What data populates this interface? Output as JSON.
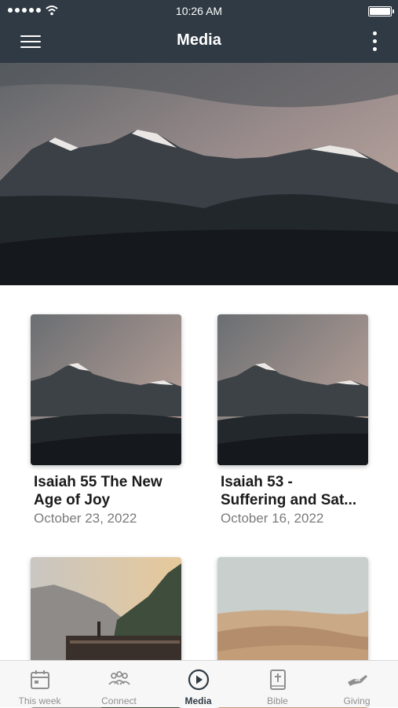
{
  "status": {
    "time": "10:26 AM"
  },
  "nav": {
    "title": "Media"
  },
  "items": [
    {
      "title": "Isaiah 55 The New\nAge of Joy",
      "date": "October 23, 2022"
    },
    {
      "title": "Isaiah 53 -\nSuffering and Sat...",
      "date": "October 16, 2022"
    }
  ],
  "tabs": [
    {
      "label": "This week",
      "icon": "calendar-icon"
    },
    {
      "label": "Connect",
      "icon": "people-icon"
    },
    {
      "label": "Media",
      "icon": "play-circle-icon",
      "active": true
    },
    {
      "label": "Bible",
      "icon": "bible-icon"
    },
    {
      "label": "Giving",
      "icon": "giving-hand-icon"
    }
  ],
  "colors": {
    "header": "#2f3a44",
    "tab_active": "#2f3a44",
    "tab_inactive": "#8f8f8f"
  }
}
